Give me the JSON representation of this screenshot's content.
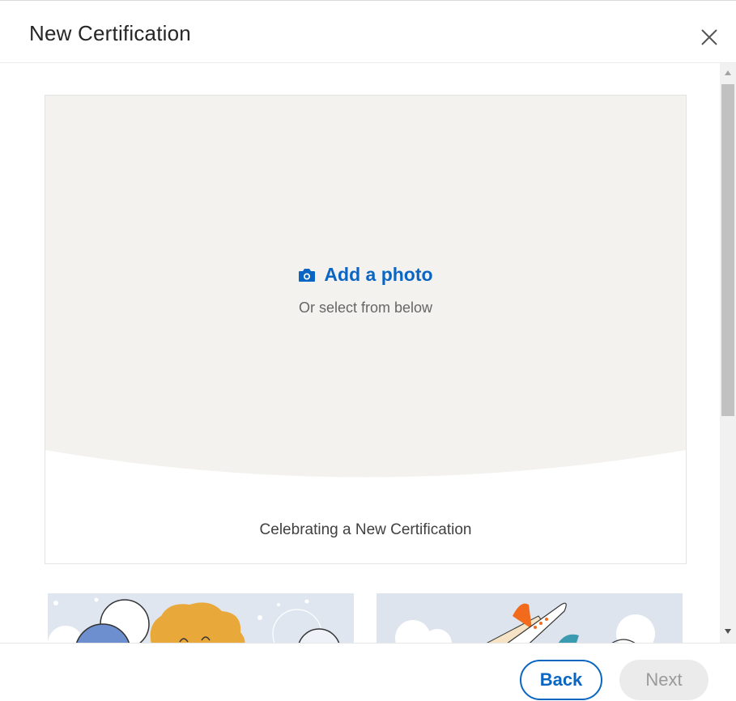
{
  "modal": {
    "title": "New Certification"
  },
  "preview": {
    "add_photo_label": "Add a photo",
    "subtext": "Or select from below",
    "caption": "Celebrating a New Certification"
  },
  "templates": [
    {
      "name": "celebration-balloons"
    },
    {
      "name": "airplane"
    }
  ],
  "footer": {
    "back_label": "Back",
    "next_label": "Next"
  },
  "colors": {
    "accent": "#0a66c2",
    "preview_bg": "#f3f2ef",
    "disabled_bg": "#ebebeb",
    "disabled_text": "#9a9a9a"
  },
  "icons": {
    "close": "close-icon",
    "camera": "camera-icon"
  }
}
